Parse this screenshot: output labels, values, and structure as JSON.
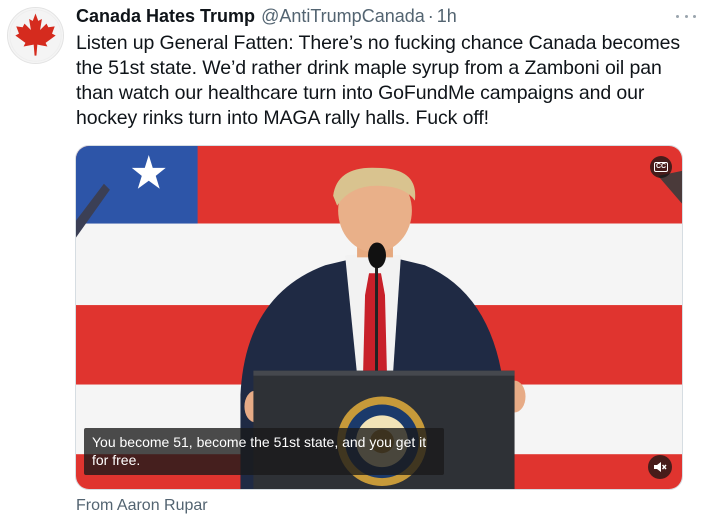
{
  "tweet": {
    "author_name": "Canada Hates Trump",
    "handle": "@AntiTrumpCanada",
    "separator": "·",
    "time": "1h",
    "text": "Listen up General Fatten: There’s no fucking chance Canada becomes\nthe 51st state. We’d rather drink maple syrup from a Zamboni oil pan\nthan watch our healthcare turn into GoFundMe campaigns and our\nhockey rinks turn into MAGA rally halls. Fuck off!",
    "more_icon": "more-horizontal-icon"
  },
  "avatar": {
    "icon": "maple-leaf-icon",
    "leaf_color": "#d52b1e"
  },
  "media": {
    "captions_badge": "CC",
    "caption": "You become 51, become the 51st state, and you get it for free.",
    "seal_text": "SEAL OF THE PRESIDENT OF THE UNITED STATES",
    "mute_icon": "volume-muted-icon",
    "colors": {
      "flag_red": "#e0342f",
      "flag_white": "#f5f5f5",
      "flag_blue": "#2d55a8",
      "podium": "#2e3136",
      "suit": "#1f2a44",
      "tie": "#c8202a"
    }
  },
  "source": {
    "label": "From Aaron Rupar"
  }
}
